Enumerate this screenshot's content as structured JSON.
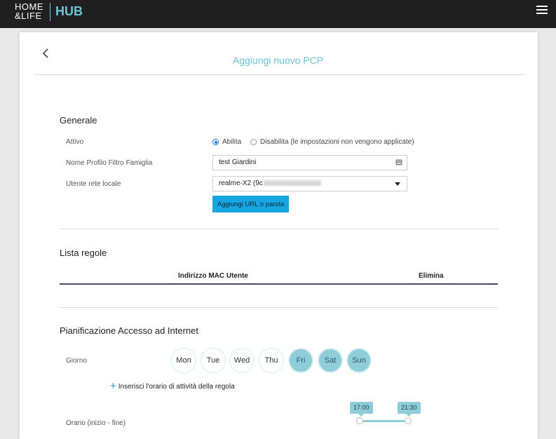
{
  "header": {
    "logo_top": "HOME",
    "logo_bottom": "&LIFE",
    "brand": "HUB"
  },
  "page": {
    "title": "Aggiungi nuovo PCP"
  },
  "general": {
    "title": "Generale",
    "active_label": "Attivo",
    "enable_label": "Abilita",
    "disable_label": "Disabilita (le impostazioni non vengono applicate)",
    "enabled": true,
    "profile_label": "Nome Profilo Filtro Famiglia",
    "profile_value": "test Giardini",
    "user_label": "Utente rete locale",
    "user_value": "realme-X2 (9c",
    "add_url_button": "Aggiungi URL o parola"
  },
  "rules": {
    "title": "Lista regole",
    "columns": [
      "Indirizzo MAC Utente",
      "Elimina"
    ]
  },
  "schedule": {
    "title": "Pianificazione Accesso ad Internet",
    "day_label": "Giorno",
    "days": [
      {
        "label": "Mon",
        "selected": false
      },
      {
        "label": "Tue",
        "selected": false
      },
      {
        "label": "Wed",
        "selected": false
      },
      {
        "label": "Thu",
        "selected": false
      },
      {
        "label": "Fri",
        "selected": true
      },
      {
        "label": "Sat",
        "selected": true
      },
      {
        "label": "Sun",
        "selected": true
      }
    ],
    "add_time_label": "Inserisci l'orario di attività della regola",
    "time_label": "Orario (inizio - fine)",
    "start_time": "17:00",
    "end_time": "21:30"
  },
  "colors": {
    "accent": "#6fc3d6",
    "button": "#18a6e3",
    "topbar": "#1f1f1f",
    "day_selected": "#8fcdd9"
  }
}
